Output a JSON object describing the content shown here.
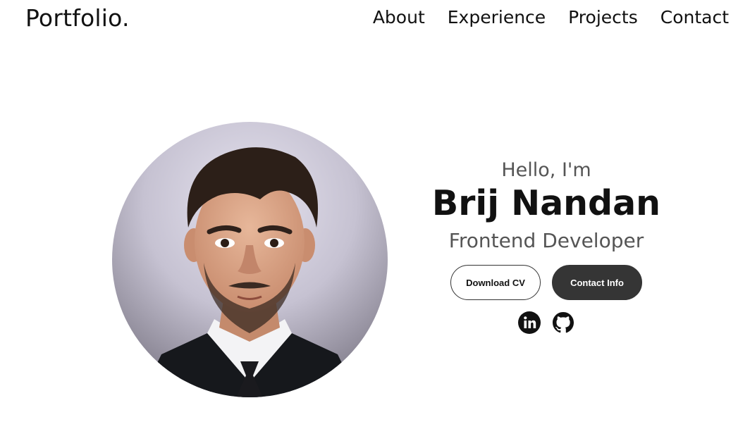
{
  "header": {
    "logo": "Portfolio.",
    "nav": [
      "About",
      "Experience",
      "Projects",
      "Contact"
    ]
  },
  "hero": {
    "greeting": "Hello, I'm",
    "name": "Brij Nandan",
    "role": "Frontend Developer",
    "buttons": {
      "download": "Download CV",
      "contact": "Contact Info"
    },
    "socials": [
      "linkedin-icon",
      "github-icon"
    ]
  },
  "colors": {
    "text": "#111111",
    "muted": "#555555",
    "button_dark": "#353535"
  }
}
